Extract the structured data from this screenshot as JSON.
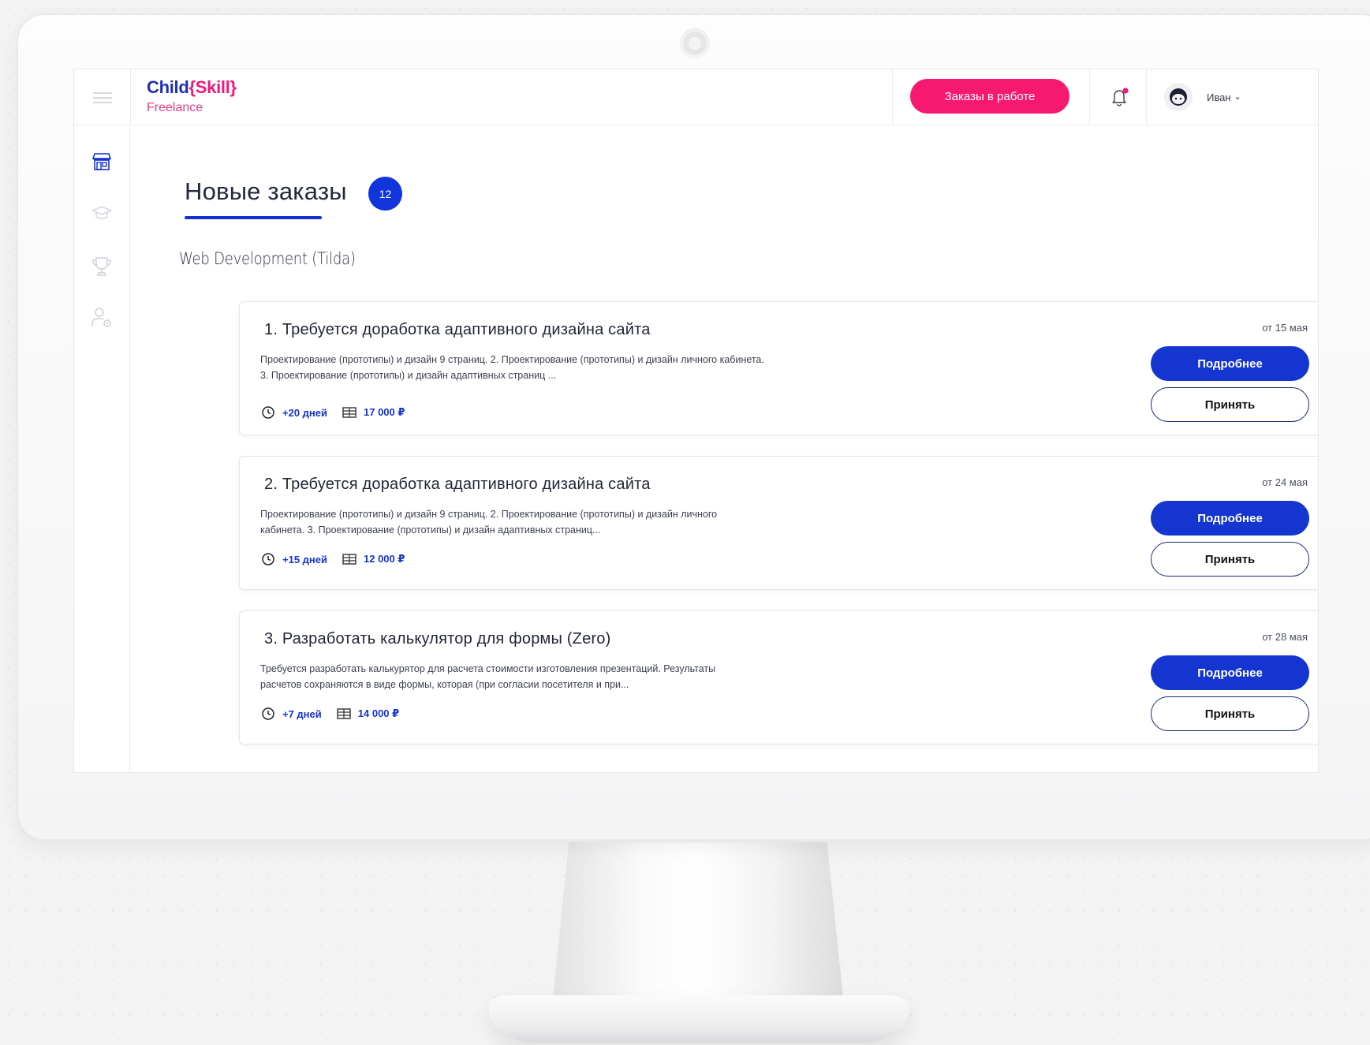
{
  "header": {
    "logo_prefix": "Child",
    "logo_open": "{",
    "logo_skill": "Skill",
    "logo_close": "}",
    "logo_sub": "Freelance",
    "orders_in_progress_button": "Заказы в работе",
    "user_name": "Иван",
    "notification_dot_color": "#f0187a"
  },
  "sidebar": {
    "items": [
      {
        "icon": "store-icon",
        "active": true
      },
      {
        "icon": "graduation-cap-icon",
        "active": false
      },
      {
        "icon": "trophy-icon",
        "active": false
      },
      {
        "icon": "user-settings-icon",
        "active": false
      }
    ]
  },
  "main": {
    "title": "Новые заказы",
    "count": "12",
    "category": "Web Development (Tilda)"
  },
  "orders": [
    {
      "title": "1. Требуется доработка адаптивного дизайна сайта",
      "date": "от 15 мая",
      "desc_line1": "Проектирование (прототипы) и дизайн 9 страниц. 2. Проектирование (прототипы) и дизайн личного кабинета.",
      "desc_line2": "3. Проектирование (прототипы) и дизайн адаптивных страниц ...",
      "deadline": "+20 дней",
      "price": "17 000 ₽",
      "more_label": "Подробнее",
      "accept_label": "Принять"
    },
    {
      "title": "2. Требуется доработка адаптивного дизайна сайта",
      "date": "от 24 мая",
      "desc_line1": "Проектирование (прототипы) и дизайн 9 страниц. 2. Проектирование (прототипы) и дизайн личного",
      "desc_line2": "кабинета. 3. Проектирование (прототипы) и дизайн адаптивных страниц...",
      "deadline": "+15 дней",
      "price": "12 000 ₽",
      "more_label": "Подробнее",
      "accept_label": "Принять"
    },
    {
      "title": "3. Разработать калькулятор для формы (Zero)",
      "date": "от 28 мая",
      "desc_line1": "Требуется разработать калькурятор для расчета стоимости изготовления презентаций. Результаты",
      "desc_line2": "расчетов сохраняются в виде формы, которая (при согласии посетителя и при...",
      "deadline": "+7 дней",
      "price": "14 000 ₽",
      "more_label": "Подробнее",
      "accept_label": "Принять"
    }
  ],
  "colors": {
    "primary_blue": "#1435cf",
    "accent_pink": "#f7196f",
    "logo_pink": "#e33a8b"
  }
}
